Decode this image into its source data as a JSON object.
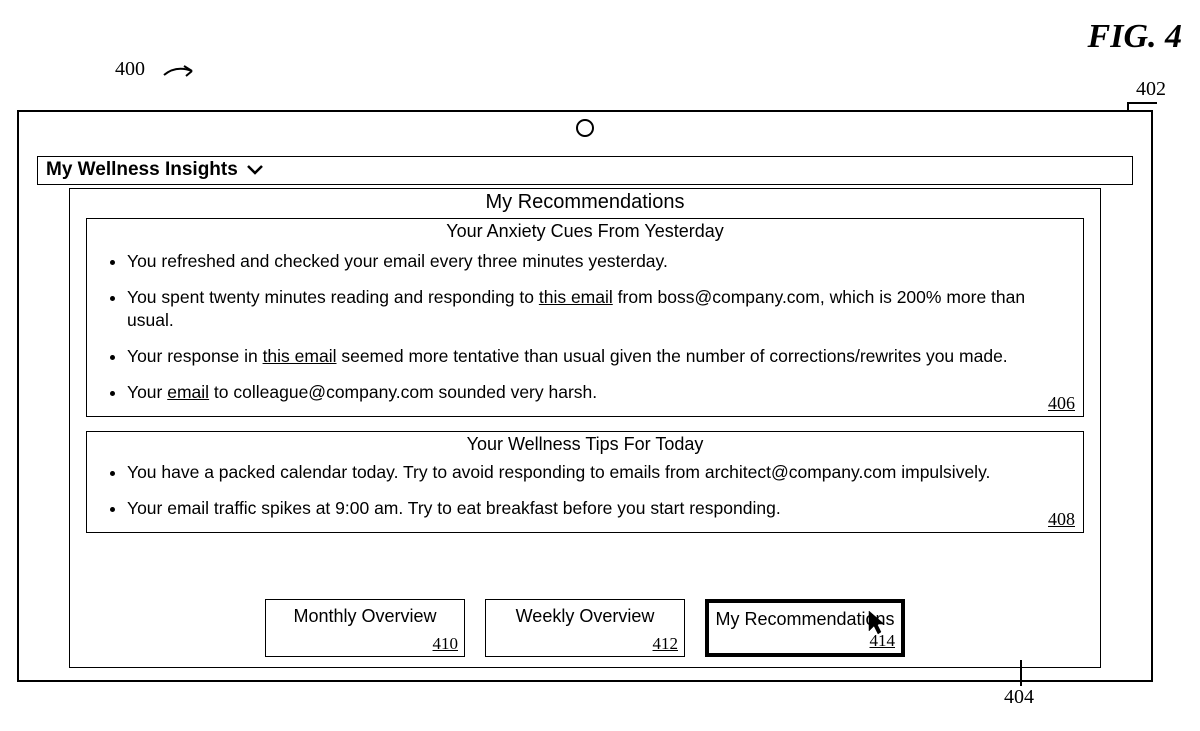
{
  "figure": {
    "title": "FIG. 4",
    "ref_top_left": "400",
    "ref_top_right": "402",
    "ref_bottom": "404"
  },
  "header": {
    "title": "My Wellness Insights"
  },
  "recommendations": {
    "title": "My Recommendations",
    "anxiety_card": {
      "title": "Your Anxiety Cues From Yesterday",
      "ref": "406",
      "items": {
        "0": {
          "pre": "You refreshed and checked your email every three minutes yesterday.",
          "link": "",
          "mid": "",
          "link2": "",
          "post": ""
        },
        "1": {
          "pre": "You spent twenty minutes reading and responding to ",
          "link": "this email",
          "mid": " from boss@company.com, which is 200% more than usual.",
          "link2": "",
          "post": ""
        },
        "2": {
          "pre": "Your response in ",
          "link": "this email",
          "mid": " seemed more tentative than usual given the number of corrections/rewrites you made.",
          "link2": "",
          "post": ""
        },
        "3": {
          "pre": "Your ",
          "link": "email",
          "mid": " to colleague@company.com sounded very harsh.",
          "link2": "",
          "post": ""
        }
      }
    },
    "tips_card": {
      "title": "Your Wellness Tips For Today",
      "ref": "408",
      "items": {
        "0": "You have a packed calendar today. Try to avoid responding to emails from architect@company.com impulsively.",
        "1": "Your email traffic spikes at 9:00 am.  Try to eat breakfast before you start responding."
      }
    }
  },
  "buttons": {
    "monthly": {
      "label": "Monthly Overview",
      "ref": "410"
    },
    "weekly": {
      "label": "Weekly Overview",
      "ref": "412"
    },
    "myrec": {
      "label": "My Recommendations",
      "ref": "414"
    }
  }
}
